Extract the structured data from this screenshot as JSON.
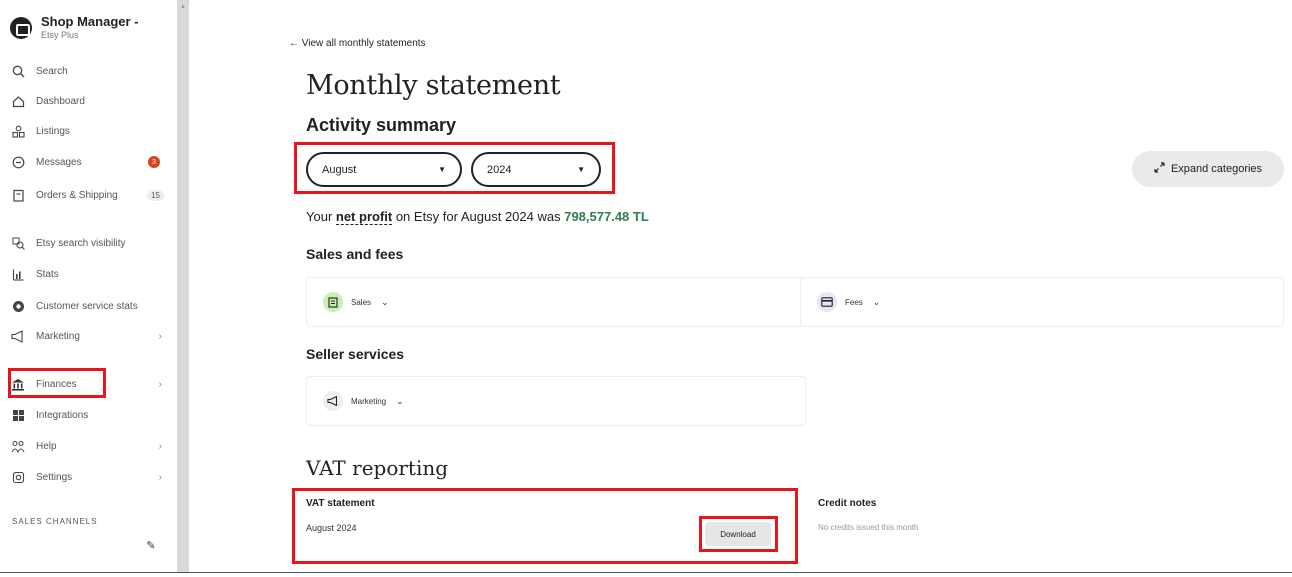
{
  "sidebar": {
    "brand_title": "Shop Manager -",
    "brand_subtitle": "Etsy Plus",
    "items": [
      {
        "label": "Search"
      },
      {
        "label": "Dashboard"
      },
      {
        "label": "Listings"
      },
      {
        "label": "Messages",
        "badge": "3"
      },
      {
        "label": "Orders & Shipping",
        "count": "15"
      },
      {
        "label": "Etsy search visibility"
      },
      {
        "label": "Stats"
      },
      {
        "label": "Customer service stats"
      },
      {
        "label": "Marketing"
      },
      {
        "label": "Finances"
      },
      {
        "label": "Integrations"
      },
      {
        "label": "Help"
      },
      {
        "label": "Settings"
      }
    ],
    "section_label": "SALES CHANNELS",
    "chevron": "›",
    "edit_icon": "✎"
  },
  "main": {
    "back_link": "← View all monthly statements",
    "page_title": "Monthly statement",
    "activity_title": "Activity summary",
    "month_select": "August",
    "year_select": "2024",
    "caret": "▼",
    "expand_button": "Expand categories",
    "profit": {
      "prefix": "Your ",
      "term": "net profit",
      "middle": " on Etsy for August 2024 was ",
      "amount": "798,577.48 TL"
    },
    "sales_fees_title": "Sales and fees",
    "sales_card": "Sales",
    "fees_card": "Fees",
    "seller_services_title": "Seller services",
    "marketing_card": "Marketing",
    "card_chevron": "⌄",
    "vat_title": "VAT reporting",
    "vat_statement_label": "VAT statement",
    "vat_month": "August 2024",
    "download_button": "Download",
    "credit_notes_title": "Credit notes",
    "credit_notes_text": "No credits issued this month"
  },
  "colors": {
    "highlight": "#e8141c",
    "profit_amount": "#2e7d4f",
    "badge": "#d4461f",
    "sales_icon_bg": "#c9efb3"
  }
}
